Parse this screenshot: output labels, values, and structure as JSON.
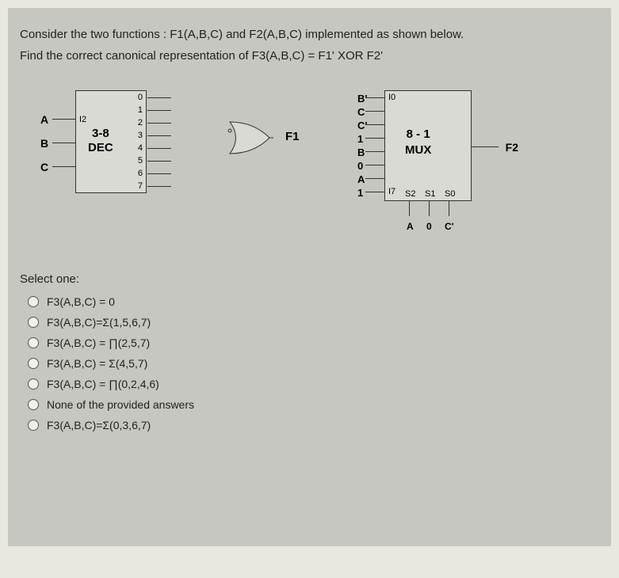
{
  "question": {
    "line1": "Consider the two functions : F1(A,B,C) and F2(A,B,C) implemented as shown below.",
    "line2": "Find the correct canonical representation of F3(A,B,C) = F1' XOR F2'"
  },
  "decoder": {
    "label_top": "3-8",
    "label_bot": "DEC",
    "inputs": [
      "A",
      "B",
      "C"
    ],
    "input_sub": [
      "I2",
      "",
      ""
    ],
    "outputs": [
      "0",
      "1",
      "2",
      "3",
      "4",
      "5",
      "6",
      "7"
    ]
  },
  "f1_label": "F1",
  "mux": {
    "label_top": "8 - 1",
    "label_bot": "MUX",
    "input_labels": [
      "B'",
      "C",
      "C'",
      "1",
      "B",
      "0",
      "A",
      "1"
    ],
    "input_i0": "I0",
    "input_i7": "I7",
    "output": "F2",
    "selects": [
      "S2",
      "S1",
      "S0"
    ],
    "select_vals": [
      "A",
      "0",
      "C'"
    ]
  },
  "select_one": "Select one:",
  "options": {
    "a": "F3(A,B,C) = 0",
    "b": "F3(A,B,C)=Σ(1,5,6,7)",
    "c": "F3(A,B,C) = ∏(2,5,7)",
    "d": "F3(A,B,C) = Σ(4,5,7)",
    "e": "F3(A,B,C) = ∏(0,2,4,6)",
    "f": "None of the provided answers",
    "g": "F3(A,B,C)=Σ(0,3,6,7)"
  }
}
